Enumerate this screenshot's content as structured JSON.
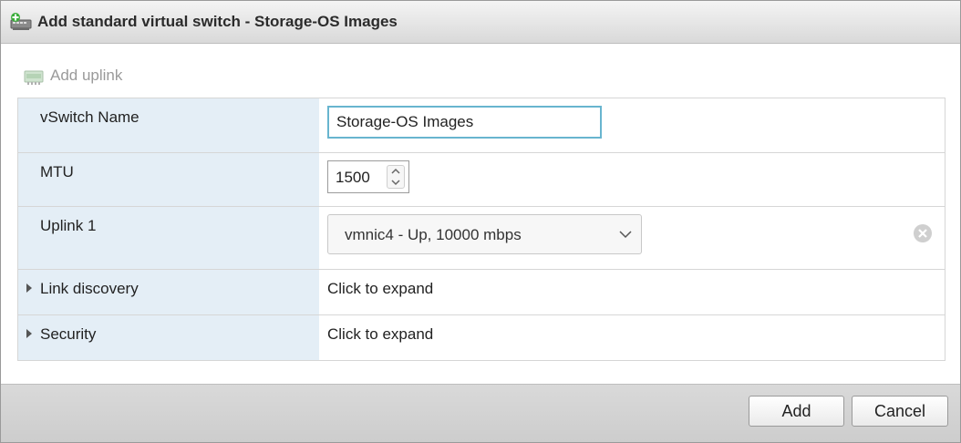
{
  "dialog": {
    "title": "Add standard virtual switch - Storage-OS Images",
    "title_icon": "virtual-switch-add-icon"
  },
  "toolbar": {
    "add_uplink_label": "Add uplink",
    "add_uplink_icon": "nic-add-icon",
    "add_uplink_enabled": false
  },
  "form": {
    "vswitch_name": {
      "label": "vSwitch Name",
      "value": "Storage-OS Images"
    },
    "mtu": {
      "label": "MTU",
      "value": "1500"
    },
    "uplink1": {
      "label": "Uplink 1",
      "selected": "vmnic4 - Up, 10000 mbps",
      "remove_icon": "remove-circle-icon"
    },
    "link_discovery": {
      "label": "Link discovery",
      "value": "Click to expand",
      "expanded": false
    },
    "security": {
      "label": "Security",
      "value": "Click to expand",
      "expanded": false
    }
  },
  "footer": {
    "add_label": "Add",
    "cancel_label": "Cancel"
  },
  "colors": {
    "label_column_bg": "#e4eef6",
    "input_focus_border": "#68b5cf",
    "disabled_text": "#9a9a9a"
  }
}
